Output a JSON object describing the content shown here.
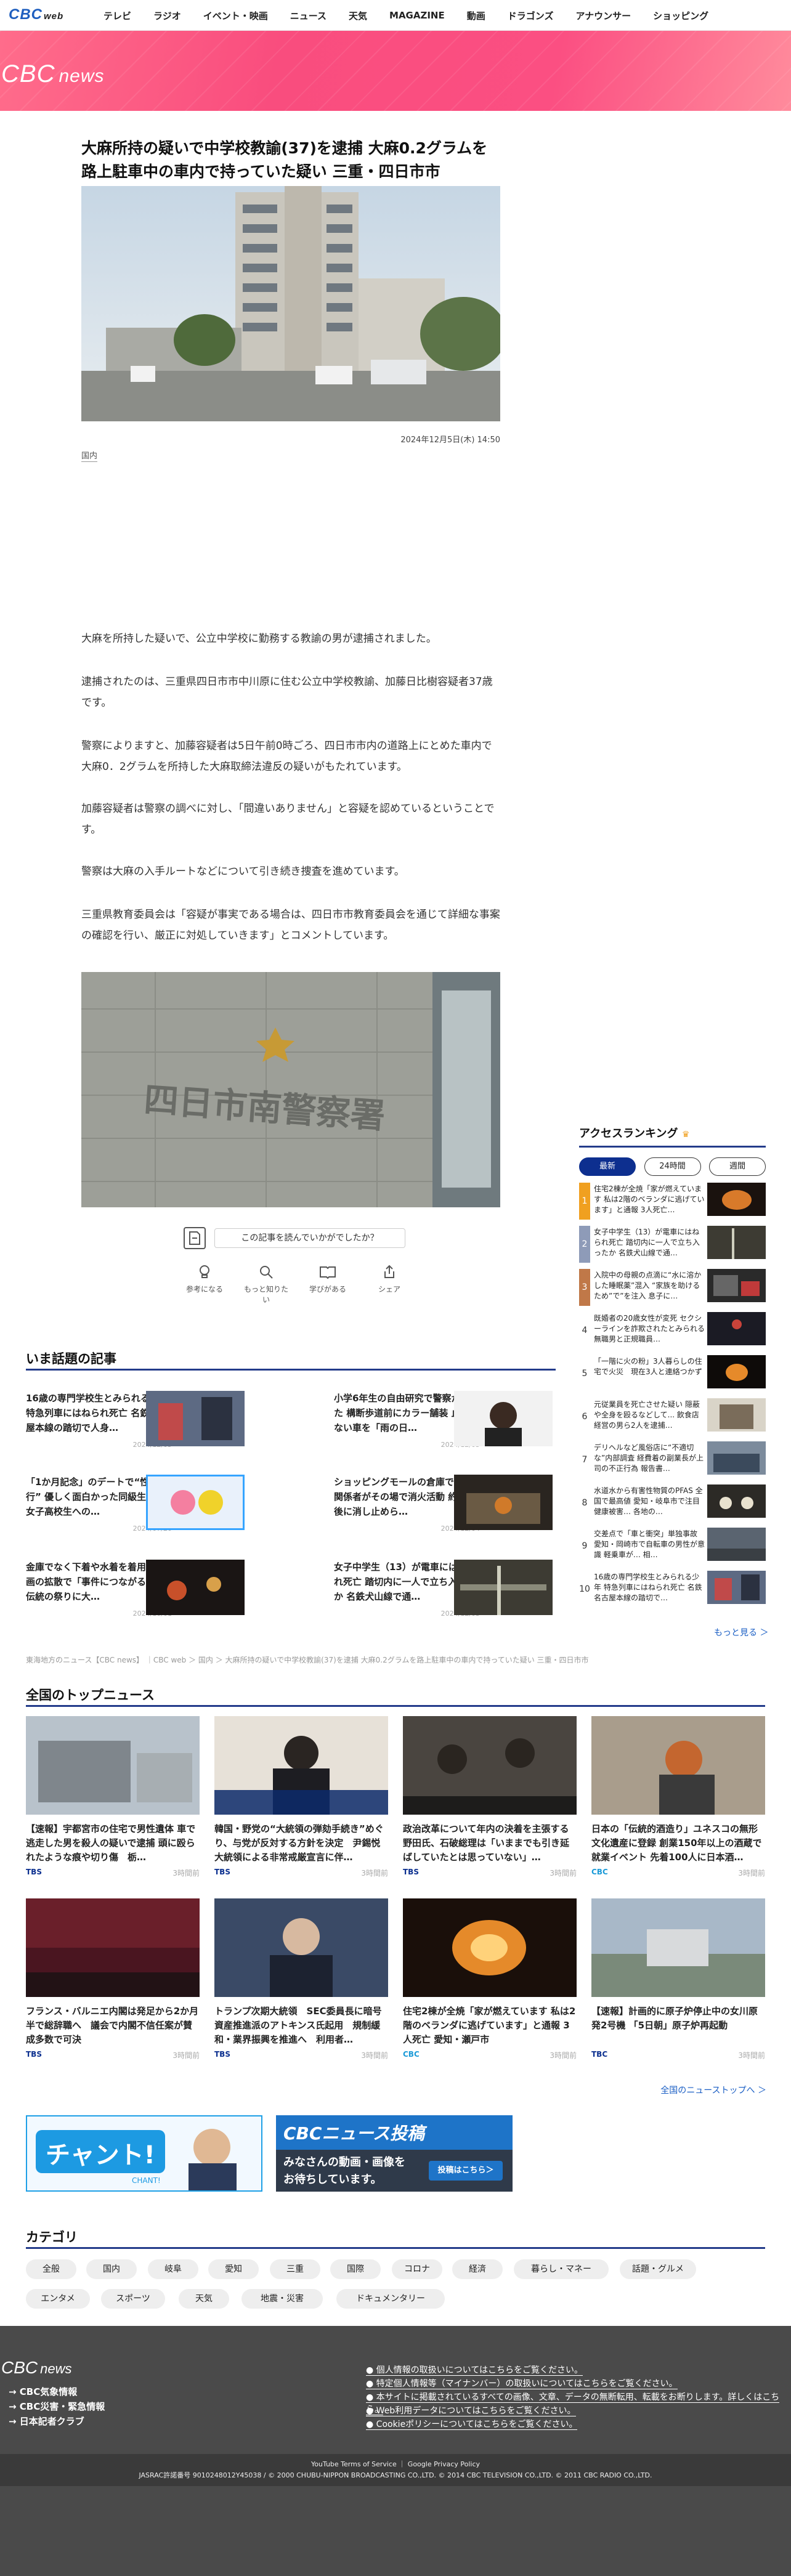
{
  "topnav": {
    "logo": "CBC",
    "logo_sub": "web",
    "items": [
      "テレビ",
      "ラジオ",
      "イベント・映画",
      "ニュース",
      "天気",
      "MAGAZINE",
      "動画",
      "ドラゴンズ",
      "アナウンサー",
      "ショッピング"
    ]
  },
  "hero": {
    "logo": "CBC",
    "logo_sub": "news"
  },
  "article": {
    "title": "大麻所持の疑いで中学校教諭(37)を逮捕 大麻0.2グラムを路上駐車中の車内で持っていた疑い 三重・四日市市",
    "date": "2024年12月5日(木) 14:50",
    "tag": "国内",
    "paragraphs": [
      "大麻を所持した疑いで、公立中学校に勤務する教諭の男が逮捕されました。",
      "逮捕されたのは、三重県四日市市中川原に住む公立中学校教諭、加藤日比樹容疑者37歳です。",
      "警察によりますと、加藤容疑者は5日午前0時ごろ、四日市市内の道路上にとめた車内で大麻0．2グラムを所持した大麻取締法違反の疑いがもたれています。",
      "加藤容疑者は警察の調べに対し、「間違いありません」と容疑を認めているということです。",
      "警察は大麻の入手ルートなどについて引き続き捜査を進めています。",
      "三重県教育委員会は「容疑が事実である場合は、四日市市教育委員会を通じて詳細な事案の確認を行い、厳正に対処していきます」とコメントしています。"
    ],
    "sign_text": "四日市南警察署"
  },
  "feedback": {
    "question": "この記事を読んでいかがでしたか？",
    "buttons": [
      "参考になる",
      "もっと知りたい",
      "学びがある",
      "シェア"
    ]
  },
  "watercooler": {
    "title": "いま話題の記事",
    "items": [
      {
        "title": "16歳の専門学校生とみられる少年 特急列車にはねられ死亡 名鉄名古屋本線の踏切で人身…",
        "date": "2024/12/05"
      },
      {
        "title": "小学6年生の自由研究で警察が動いた 構断歩道前にカラー舗装 止まらない車を「雨の日…",
        "date": "2024/12/05"
      },
      {
        "title": "「1か月記念」のデートで“性的暴行” 優しく面白かった同級生が豹変 女子高校生への…",
        "date": "2024/07/20"
      },
      {
        "title": "ショッピングモールの倉庫で火事 関係者がその場で消火活動 約1時間後に消し止めら…",
        "date": "2024/12/04"
      },
      {
        "title": "金庫でなく下着や水着を着用へ 動画の拡散で「事件につながる恐れ」 伝統の祭りに大…",
        "date": "2024/10/01"
      },
      {
        "title": "女子中学生（13）が電車にはねられ死亡 踏切内に一人で立ち入ったか 名鉄犬山線で通…",
        "date": "2024/12/03"
      }
    ]
  },
  "breadcrumb": "東海地方のニュース【CBC news】 ｜CBC web ＞ 国内 ＞ 大麻所持の疑いで中学校教諭(37)を逮捕 大麻0.2グラムを路上駐車中の車内で持っていた疑い 三重・四日市市",
  "national": {
    "title": "全国のトップニュース",
    "items": [
      {
        "title": "【速報】宇都宮市の住宅で男性遺体 車で逃走した男を殺人の疑いで逮捕 頭に殴られたような痕や切り傷　栃…",
        "source": "TBS",
        "age": "3時間前"
      },
      {
        "title": "韓国・野党の“大統領の弾劾手続き”めぐり、与党が反対する方針を決定　尹錫悦大統領による非常戒厳宣言に伴…",
        "source": "TBS",
        "age": "3時間前"
      },
      {
        "title": "政治改革について年内の決着を主張する野田氏、石破総理は「いままでも引き延ばしていたとは思っていない」…",
        "source": "TBS",
        "age": "3時間前"
      },
      {
        "title": "日本の「伝統的酒造り」ユネスコの無形文化遺産に登録 創業150年以上の酒蔵で就業イベント 先着100人に日本酒…",
        "source": "CBC",
        "age": "3時間前"
      },
      {
        "title": "フランス・バルニエ内閣は発足から2か月半で総辞職へ　議会で内閣不信任案が賛成多数で可決",
        "source": "TBS",
        "age": "3時間前"
      },
      {
        "title": "トランプ次期大統領　SEC委員長に暗号資産推進派のアトキンス氏起用　規制緩和・業界振興を推進へ　利用者…",
        "source": "TBS",
        "age": "3時間前"
      },
      {
        "title": "住宅2棟が全焼「家が燃えています 私は2階のベランダに逃げています」と通報 3人死亡 愛知・瀬戸市",
        "source": "CBC",
        "age": "3時間前"
      },
      {
        "title": "【速報】計画的に原子炉停止中の女川原発2号機 「5日朝」原子炉再起動",
        "source": "TBC",
        "age": "3時間前"
      }
    ],
    "more": "全国のニューストップへ ＞"
  },
  "banners": {
    "chant": {
      "text": "チャント!",
      "sub": "CHANT!"
    },
    "post": {
      "title": "CBCニュース投稿",
      "line1": "みなさんの動画・画像を",
      "line2": "お待ちしています。",
      "button": "投稿はこちら＞"
    }
  },
  "categories": {
    "title": "カテゴリ",
    "items": [
      "全般",
      "国内",
      "岐阜",
      "愛知",
      "三重",
      "国際",
      "コロナ",
      "経済",
      "暮らし・マネー",
      "話題・グルメ",
      "エンタメ",
      "スポーツ",
      "天気",
      "地震・災害",
      "ドキュメンタリー"
    ]
  },
  "ranking": {
    "title": "アクセスランキング",
    "tabs": [
      "最新",
      "24時間",
      "週間"
    ],
    "items": [
      {
        "rank": "1",
        "title": "住宅2棟が全焼「家が燃えています 私は2階のベランダに逃げています」と通報 3人死亡…"
      },
      {
        "rank": "2",
        "title": "女子中学生（13）が電車にはねられ死亡 踏切内に一人で立ち入ったか 名鉄犬山線で通…"
      },
      {
        "rank": "3",
        "title": "入院中の母親の点滴に“水に溶かした睡眠薬”混入 “家族を助けるため”で”を注入 息子に…"
      },
      {
        "rank": "4",
        "title": "既婚者の20歳女性が変死 セクシーラインを詐欺されたとみられる無職男と正規職員…"
      },
      {
        "rank": "5",
        "title": "「一階に火の粉」3人暮らしの住宅で火災　現在3人と連絡つかず"
      },
      {
        "rank": "6",
        "title": "元従業員を死亡させた疑い 隠蔽や全身を殴るなどして... 飲食店経営の男ら2人を逮捕…"
      },
      {
        "rank": "7",
        "title": "デリヘルなど風俗店に“不適切な”内部調査 経費着の副業長が上司の不正行為 報告書…"
      },
      {
        "rank": "8",
        "title": "水道水から有害性物質のPFAS 全国で最高値 愛知・岐阜市で注目 健康被害… 各地の…"
      },
      {
        "rank": "9",
        "title": "交差点で「車と衝突」単独事故 愛知・岡崎市で自転車の男性が意識 軽乗車が… 相…"
      },
      {
        "rank": "10",
        "title": "16歳の専門学校生とみられる少年 特急列車にはねられ死亡 名鉄名古屋本線の踏切で…"
      }
    ],
    "more": "もっと見る ＞"
  },
  "footer": {
    "logo": "CBC",
    "logo_sub": "news",
    "left_links": [
      "CBC気象情報",
      "CBC災害・緊急情報",
      "日本記者クラブ"
    ],
    "right_links": [
      "● 個人情報の取扱いについてはこちらをご覧ください。",
      "● 特定個人情報等（マイナンバー）の取扱いについてはこちらをご覧ください。",
      "● 本サイトに掲載されているすべての画像、文章、データの無断転用、転載をお断りします。詳しくはこちら。",
      "● Web利用データについてはこちらをご覧ください。",
      "● Cookieポリシーについてはこちらをご覧ください。"
    ],
    "policy": "YouTube Terms of Service ｜ Google Privacy Policy",
    "copyright": "JASRAC許諾番号 9010248012Y45038 / © 2000 CHUBU-NIPPON BROADCASTING CO.,LTD. © 2014 CBC TELEVISION CO.,LTD. © 2011 CBC RADIO CO.,LTD."
  },
  "colors": {
    "accent": "#233b8a",
    "hero": "#fb4f82",
    "link": "#1a5ec4",
    "footer": "#4a4a4a"
  }
}
